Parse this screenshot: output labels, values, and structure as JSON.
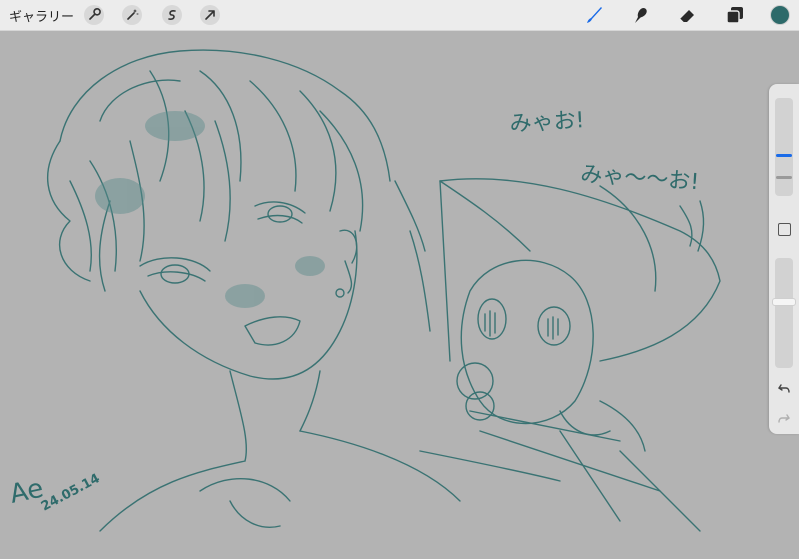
{
  "toolbar": {
    "gallery_label": "ギャラリー",
    "left_icons": [
      "wrench-icon",
      "magic-wand-icon",
      "selection-s-icon",
      "transform-arrow-icon"
    ],
    "right_icons": [
      "brush-icon",
      "smudge-icon",
      "eraser-icon",
      "layers-icon"
    ],
    "color_swatch": "#2d6a6a",
    "active_tool_color": "#1a6be8"
  },
  "artwork": {
    "text_line_1": "みゃお!",
    "text_line_2": "みゃ〜〜お!",
    "signature_initials": "Ae",
    "signature_date": "24.05.14",
    "ink_color": "#3a7373"
  },
  "sidebar": {
    "controls": [
      "brush-size-slider",
      "modify-button",
      "opacity-slider",
      "undo-button",
      "redo-button"
    ]
  }
}
